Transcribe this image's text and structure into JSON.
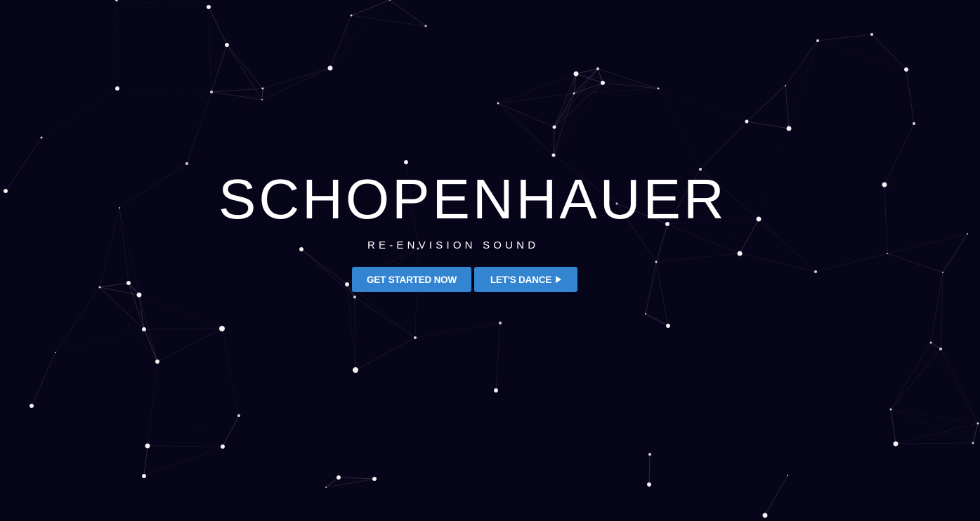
{
  "hero": {
    "title": "SCHOPENHAUER",
    "subtitle": "RE-ENVISION SOUND",
    "primary_button": "GET STARTED NOW",
    "secondary_button": "LET'S DANCE"
  },
  "icons": {
    "secondary_button_icon": "play-icon"
  },
  "colors": {
    "background": "#07051a",
    "button": "#3385d1",
    "text": "#ffffff",
    "particle": "#ffffff",
    "link_line": "#6a6378"
  }
}
